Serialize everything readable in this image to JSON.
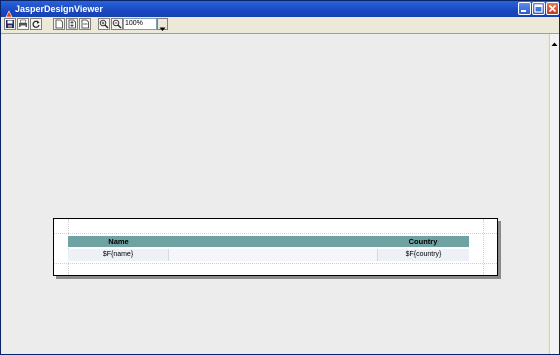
{
  "window": {
    "title": "JasperDesignViewer"
  },
  "toolbar": {
    "buttons": [
      "save-icon",
      "print-icon",
      "reload-icon",
      "first-page-icon",
      "fit-page-icon",
      "fit-width-icon",
      "zoom-in-icon",
      "zoom-out-icon"
    ],
    "zoom_value": "100%"
  },
  "report": {
    "header": {
      "name_label": "Name",
      "country_label": "Country"
    },
    "detail": {
      "name_field": "$F{name}",
      "country_field": "$F{country}"
    }
  },
  "colors": {
    "titlebar": "#1a48c0",
    "column_header": "#6fa3a3",
    "detail_row": "#eef0f8",
    "canvas": "#ececec"
  }
}
